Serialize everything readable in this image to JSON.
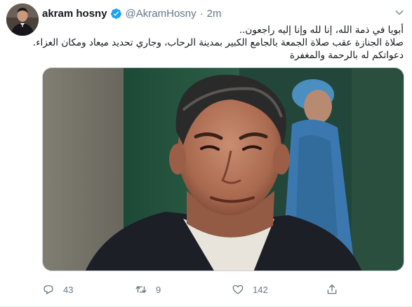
{
  "tweet": {
    "author_name": "akram hosny",
    "handle": "@AkramHosny",
    "separator": "·",
    "time": "2m",
    "lines": [
      "أبويا في ذمة الله، إنا لله وإنا إليه راجعون..",
      "صلاة الجنازة عقب صلاة الجمعة بالجامع الكبير بمدينة الرحاب، وجاري تحديد ميعاد ومكان العزاء.",
      "دعواتكم له بالرحمة والمغفرة"
    ]
  },
  "actions": {
    "reply_count": "43",
    "retweet_count": "9",
    "like_count": "142"
  },
  "icons": {
    "verified": "verified-badge-icon",
    "caret": "chevron-down-icon",
    "reply": "reply-icon",
    "retweet": "retweet-icon",
    "like": "heart-icon",
    "share": "share-icon"
  },
  "colors": {
    "name": "#14171a",
    "secondary": "#657786",
    "verified": "#1da1f2",
    "border": "#e6ecf0"
  }
}
